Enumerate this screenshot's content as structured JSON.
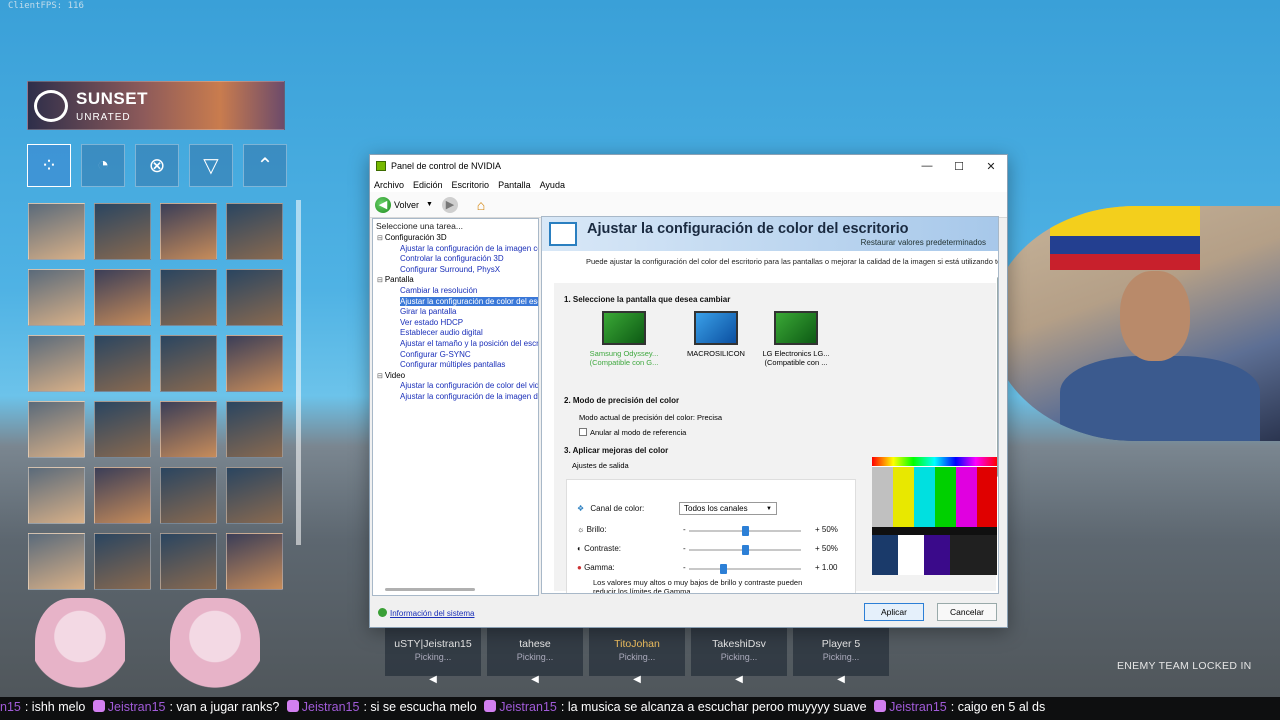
{
  "game": {
    "fps_label": "ClientFPS: 116",
    "map_name": "SUNSET",
    "mode": "UNRATED",
    "role_filters": [
      "all",
      "duelist",
      "controller",
      "sentinel",
      "initiator"
    ],
    "team": [
      {
        "name": "uSTY|Jeistran15",
        "status": "Picking..."
      },
      {
        "name": "tahese",
        "status": "Picking..."
      },
      {
        "name": "TitoJohan",
        "status": "Picking..."
      },
      {
        "name": "TakeshiDsv",
        "status": "Picking..."
      },
      {
        "name": "Player 5",
        "status": "Picking..."
      }
    ],
    "enemy_status": "ENEMY TEAM LOCKED IN"
  },
  "chat": {
    "messages": [
      {
        "user": "n15",
        "text": ": ishh melo"
      },
      {
        "user": "Jeistran15",
        "text": ": van a jugar ranks?"
      },
      {
        "user": "Jeistran15",
        "text": ": si se escucha melo"
      },
      {
        "user": "Jeistran15",
        "text": ": la musica se alcanza a escuchar peroo muyyyy suave"
      },
      {
        "user": "Jeistran15",
        "text": ": caigo en 5 al ds"
      }
    ]
  },
  "nvidia": {
    "window_title": "Panel de control de NVIDIA",
    "menu": [
      "Archivo",
      "Edición",
      "Escritorio",
      "Pantalla",
      "Ayuda"
    ],
    "back_label": "Volver",
    "task_header": "Seleccione una tarea...",
    "tree": [
      {
        "type": "cat",
        "label": "Configuración 3D"
      },
      {
        "type": "sub",
        "label": "Ajustar la configuración de la imagen con v"
      },
      {
        "type": "sub",
        "label": "Controlar la configuración 3D"
      },
      {
        "type": "sub",
        "label": "Configurar Surround, PhysX"
      },
      {
        "type": "cat",
        "label": "Pantalla"
      },
      {
        "type": "sub",
        "label": "Cambiar la resolución"
      },
      {
        "type": "sub",
        "label": "Ajustar la configuración de color del escrito",
        "selected": true
      },
      {
        "type": "sub",
        "label": "Girar la pantalla"
      },
      {
        "type": "sub",
        "label": "Ver estado HDCP"
      },
      {
        "type": "sub",
        "label": "Establecer audio digital"
      },
      {
        "type": "sub",
        "label": "Ajustar el tamaño y la posición del escritorio"
      },
      {
        "type": "sub",
        "label": "Configurar G-SYNC"
      },
      {
        "type": "sub",
        "label": "Configurar múltiples pantallas"
      },
      {
        "type": "cat",
        "label": "Video"
      },
      {
        "type": "sub",
        "label": "Ajustar la configuración de color del video"
      },
      {
        "type": "sub",
        "label": "Ajustar la configuración de la imagen de vid"
      }
    ],
    "page_title": "Ajustar la configuración de color del escritorio",
    "restore_link": "Restaurar valores predeterminados",
    "intro": "Puede ajustar la configuración del color del escritorio para las pantallas o mejorar la calidad de la imagen si está utilizando televisores",
    "section1": "1. Seleccione la pantalla que desea cambiar",
    "monitors": [
      {
        "line1": "Samsung Odyssey...",
        "line2": "(Compatible con G...",
        "selected": true,
        "kind": "nv"
      },
      {
        "line1": "MACROSILICON",
        "line2": "",
        "selected": false,
        "kind": "ms"
      },
      {
        "line1": "LG Electronics LG...",
        "line2": "(Compatible con ...",
        "selected": false,
        "kind": "nv"
      }
    ],
    "section2": "2. Modo de precisión del color",
    "precision_text": "Modo actual de precisión del color: Precisa",
    "override_label": "Anular al modo de referencia",
    "section3": "3. Aplicar mejoras del color",
    "output_label": "Ajustes de salida",
    "channel_label": "Canal de color:",
    "channel_value": "Todos los canales",
    "sliders": [
      {
        "label": "Brillo:",
        "value": "50%",
        "fraction": 0.5
      },
      {
        "label": "Contraste:",
        "value": "50%",
        "fraction": 0.5
      },
      {
        "label": "Gamma:",
        "value": "1.00",
        "fraction": 0.3
      }
    ],
    "minus": "-",
    "plus": "+",
    "note": "Los valores muy altos o muy bajos de brillo y contraste pueden reducir los límites de Gamma.",
    "system_info": "Información del sistema",
    "apply": "Aplicar",
    "cancel": "Cancelar",
    "nvidia_green": "#76b900",
    "accent_blue": "#2c7fd6"
  }
}
